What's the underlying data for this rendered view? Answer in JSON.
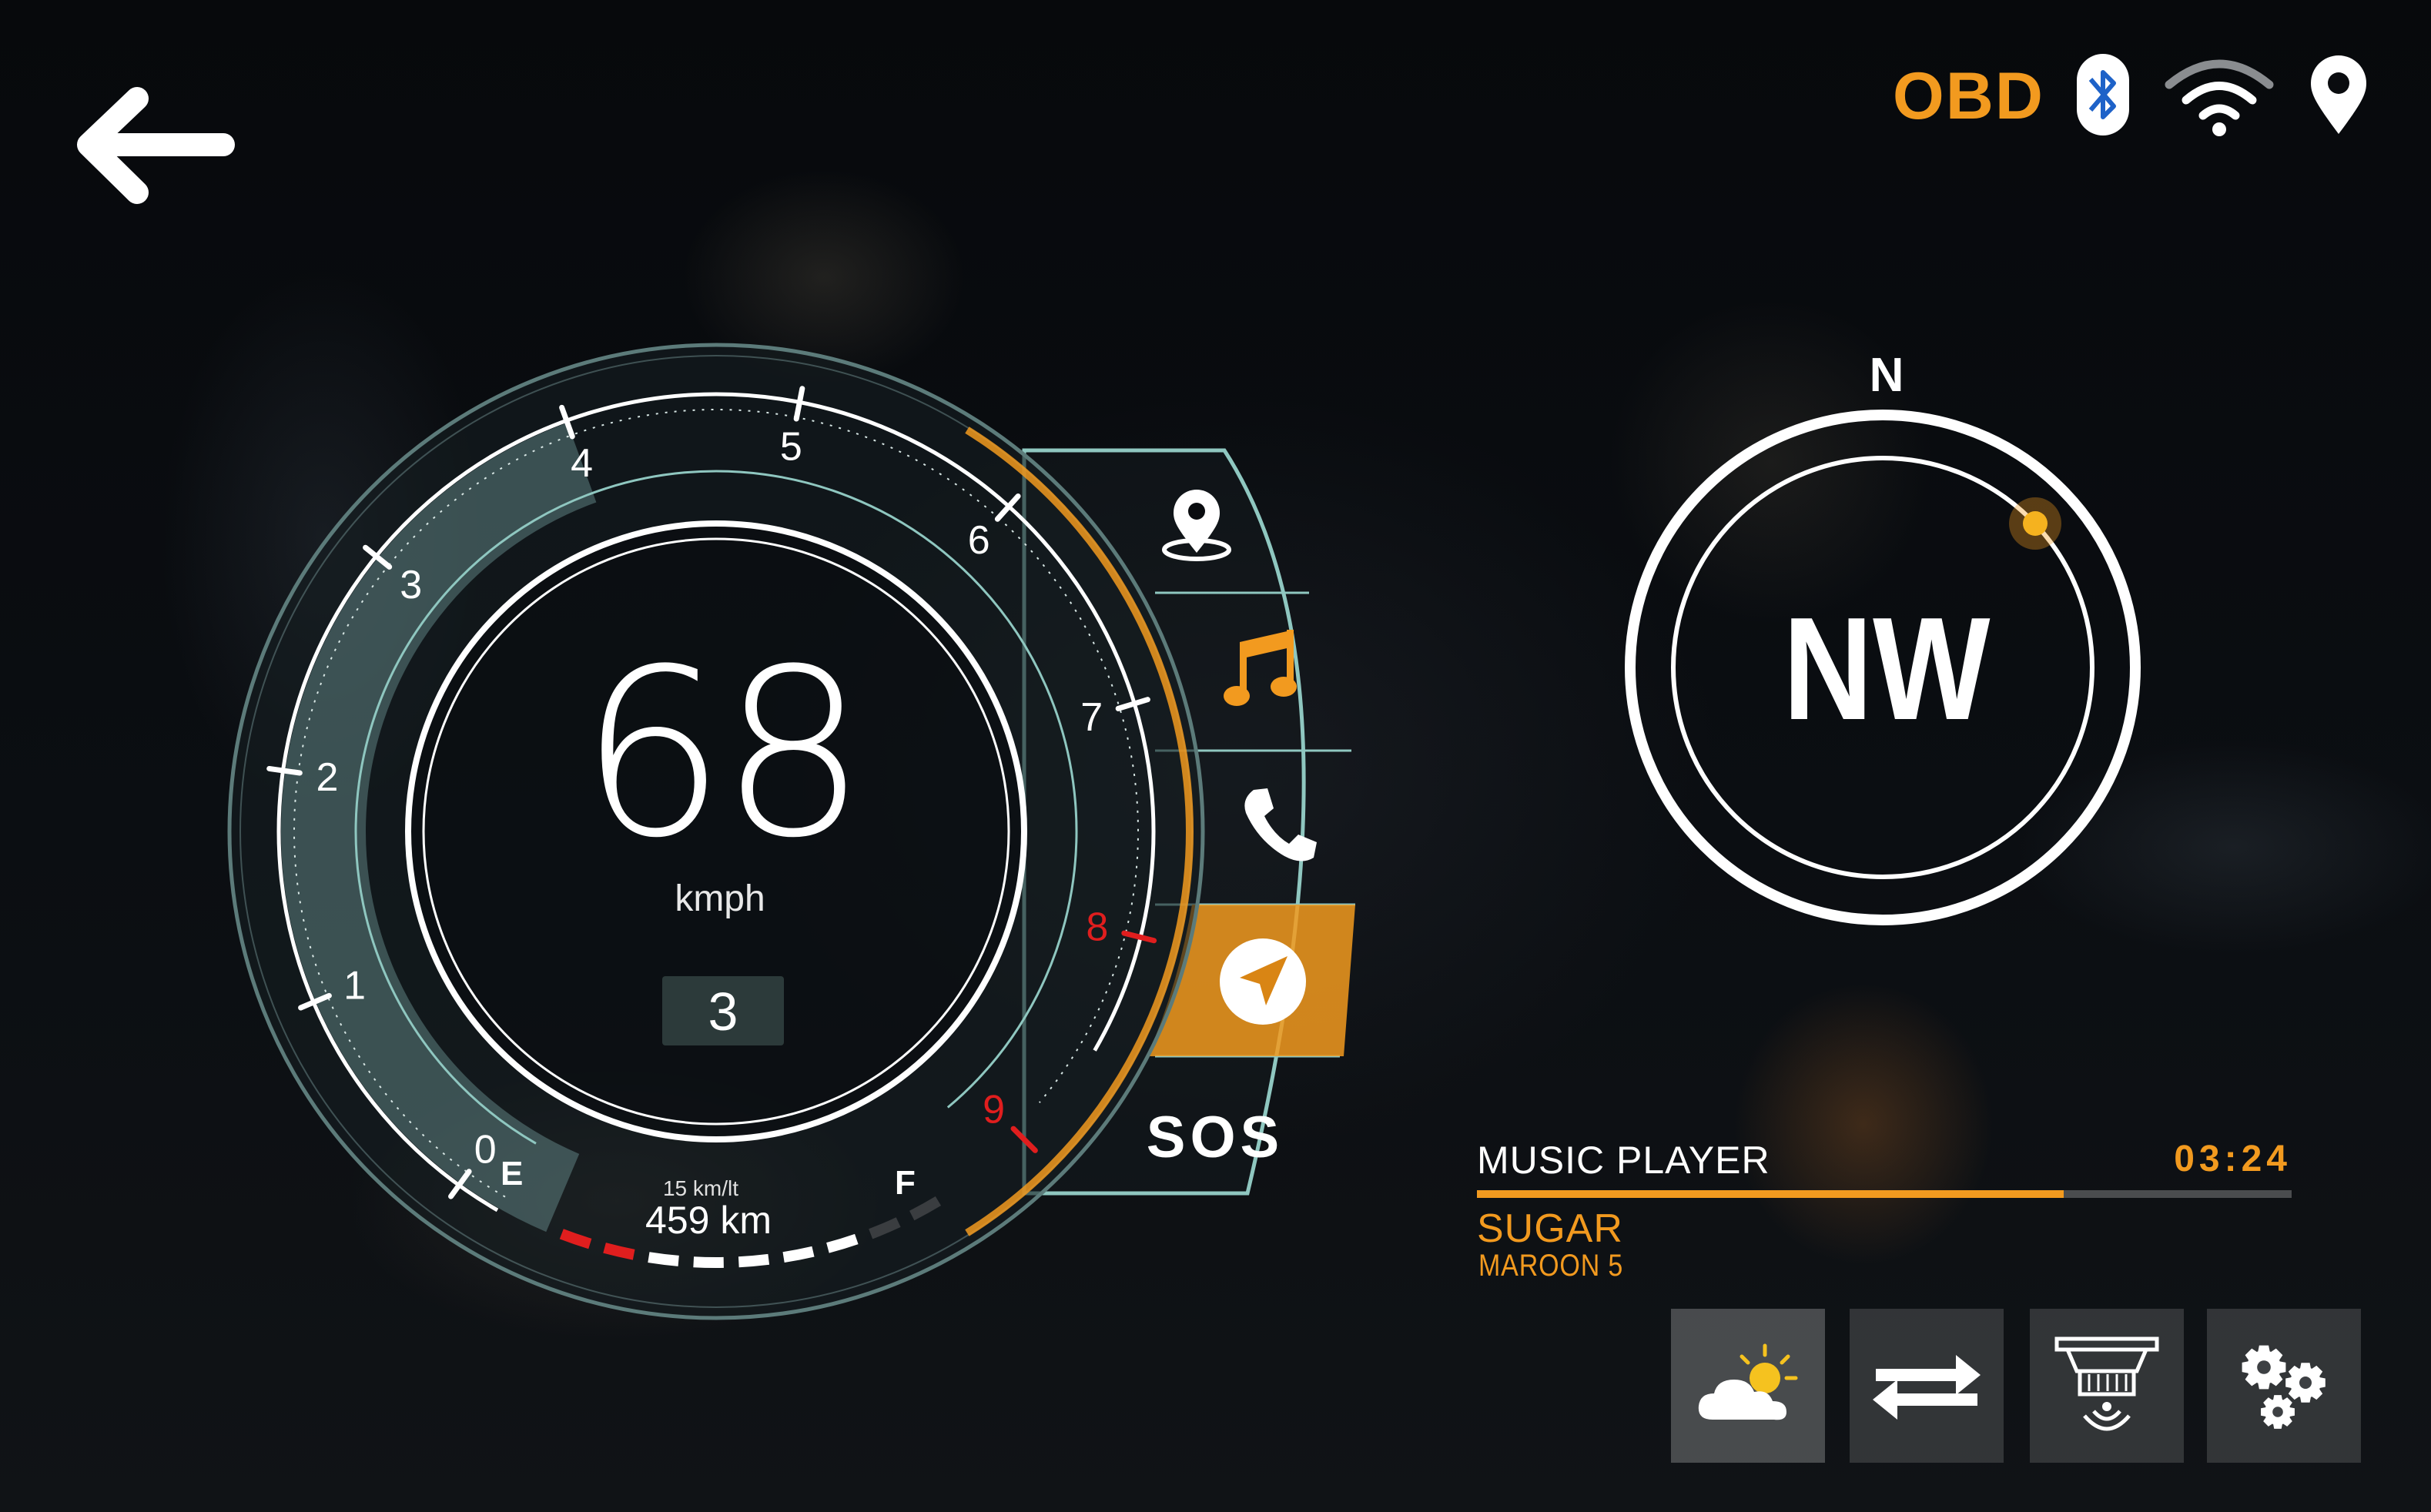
{
  "header": {
    "back_icon": "arrow-left-icon",
    "obd_label": "OBD",
    "status_icons": [
      "bluetooth-icon",
      "wifi-icon",
      "location-pin-icon"
    ]
  },
  "speedometer": {
    "speed": "68",
    "unit": "kmph",
    "gear": "3",
    "rpm_ticks": [
      "0",
      "1",
      "2",
      "3",
      "4",
      "5",
      "6",
      "7",
      "8",
      "9"
    ],
    "redline_ticks": [
      "8",
      "9"
    ],
    "fuel": {
      "empty_label": "E",
      "full_label": "F",
      "efficiency": "15 km/lt",
      "range": "459 km"
    }
  },
  "side_menu": {
    "items": [
      {
        "icon": "map-pin-icon",
        "active": false
      },
      {
        "icon": "music-note-icon",
        "active": false
      },
      {
        "icon": "phone-icon",
        "active": false
      },
      {
        "icon": "navigation-arrow-icon",
        "active": true
      }
    ],
    "sos_label": "SOS"
  },
  "compass": {
    "north_label": "N",
    "direction": "NW"
  },
  "music_player": {
    "title": "MUSIC  PLAYER",
    "time": "03:24",
    "progress": 0.72,
    "song": "SUGAR",
    "artist": "MAROON 5"
  },
  "bottom_tiles": [
    {
      "icon": "weather-cloud-sun-icon"
    },
    {
      "icon": "transfer-arrows-icon"
    },
    {
      "icon": "smoke-detector-icon"
    },
    {
      "icon": "settings-gears-icon"
    }
  ],
  "colors": {
    "accent": "#f29a1f",
    "teal": "#8fc7c0",
    "redline": "#e01e1e",
    "bluetooth": "#1e62c8"
  }
}
